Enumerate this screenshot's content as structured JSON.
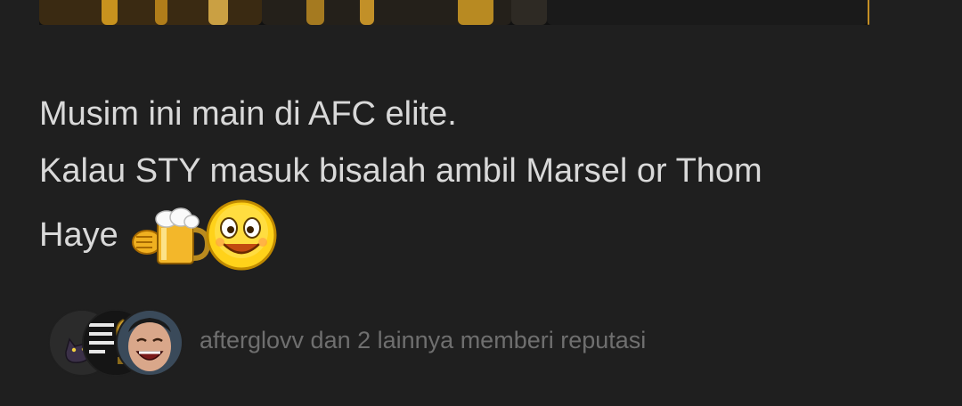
{
  "post": {
    "lines": [
      "Musim ini main di AFC elite.",
      "Kalau STY masuk bisalah ambil Marsel or Thom",
      "Haye"
    ],
    "emoji": "beer-cheers-smiley-emoji"
  },
  "reputation": {
    "text": "afterglovv dan 2 lainnya memberi reputasi",
    "avatars": [
      "cat-avatar",
      "poster-avatar",
      "laughing-man-avatar"
    ]
  },
  "colors": {
    "background": "#1f1f1f",
    "text": "#d9d9d9",
    "muted_text": "#6f6f6f"
  }
}
